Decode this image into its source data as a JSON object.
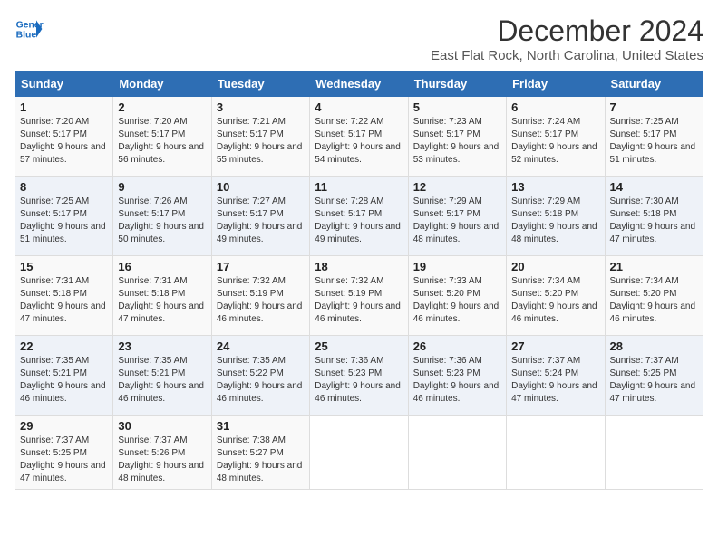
{
  "header": {
    "logo_line1": "General",
    "logo_line2": "Blue",
    "month": "December 2024",
    "location": "East Flat Rock, North Carolina, United States"
  },
  "days_of_week": [
    "Sunday",
    "Monday",
    "Tuesday",
    "Wednesday",
    "Thursday",
    "Friday",
    "Saturday"
  ],
  "weeks": [
    [
      {
        "num": "1",
        "rise": "7:20 AM",
        "set": "5:17 PM",
        "daylight": "9 hours and 57 minutes."
      },
      {
        "num": "2",
        "rise": "7:20 AM",
        "set": "5:17 PM",
        "daylight": "9 hours and 56 minutes."
      },
      {
        "num": "3",
        "rise": "7:21 AM",
        "set": "5:17 PM",
        "daylight": "9 hours and 55 minutes."
      },
      {
        "num": "4",
        "rise": "7:22 AM",
        "set": "5:17 PM",
        "daylight": "9 hours and 54 minutes."
      },
      {
        "num": "5",
        "rise": "7:23 AM",
        "set": "5:17 PM",
        "daylight": "9 hours and 53 minutes."
      },
      {
        "num": "6",
        "rise": "7:24 AM",
        "set": "5:17 PM",
        "daylight": "9 hours and 52 minutes."
      },
      {
        "num": "7",
        "rise": "7:25 AM",
        "set": "5:17 PM",
        "daylight": "9 hours and 51 minutes."
      }
    ],
    [
      {
        "num": "8",
        "rise": "7:25 AM",
        "set": "5:17 PM",
        "daylight": "9 hours and 51 minutes."
      },
      {
        "num": "9",
        "rise": "7:26 AM",
        "set": "5:17 PM",
        "daylight": "9 hours and 50 minutes."
      },
      {
        "num": "10",
        "rise": "7:27 AM",
        "set": "5:17 PM",
        "daylight": "9 hours and 49 minutes."
      },
      {
        "num": "11",
        "rise": "7:28 AM",
        "set": "5:17 PM",
        "daylight": "9 hours and 49 minutes."
      },
      {
        "num": "12",
        "rise": "7:29 AM",
        "set": "5:17 PM",
        "daylight": "9 hours and 48 minutes."
      },
      {
        "num": "13",
        "rise": "7:29 AM",
        "set": "5:18 PM",
        "daylight": "9 hours and 48 minutes."
      },
      {
        "num": "14",
        "rise": "7:30 AM",
        "set": "5:18 PM",
        "daylight": "9 hours and 47 minutes."
      }
    ],
    [
      {
        "num": "15",
        "rise": "7:31 AM",
        "set": "5:18 PM",
        "daylight": "9 hours and 47 minutes."
      },
      {
        "num": "16",
        "rise": "7:31 AM",
        "set": "5:18 PM",
        "daylight": "9 hours and 47 minutes."
      },
      {
        "num": "17",
        "rise": "7:32 AM",
        "set": "5:19 PM",
        "daylight": "9 hours and 46 minutes."
      },
      {
        "num": "18",
        "rise": "7:32 AM",
        "set": "5:19 PM",
        "daylight": "9 hours and 46 minutes."
      },
      {
        "num": "19",
        "rise": "7:33 AM",
        "set": "5:20 PM",
        "daylight": "9 hours and 46 minutes."
      },
      {
        "num": "20",
        "rise": "7:34 AM",
        "set": "5:20 PM",
        "daylight": "9 hours and 46 minutes."
      },
      {
        "num": "21",
        "rise": "7:34 AM",
        "set": "5:20 PM",
        "daylight": "9 hours and 46 minutes."
      }
    ],
    [
      {
        "num": "22",
        "rise": "7:35 AM",
        "set": "5:21 PM",
        "daylight": "9 hours and 46 minutes."
      },
      {
        "num": "23",
        "rise": "7:35 AM",
        "set": "5:21 PM",
        "daylight": "9 hours and 46 minutes."
      },
      {
        "num": "24",
        "rise": "7:35 AM",
        "set": "5:22 PM",
        "daylight": "9 hours and 46 minutes."
      },
      {
        "num": "25",
        "rise": "7:36 AM",
        "set": "5:23 PM",
        "daylight": "9 hours and 46 minutes."
      },
      {
        "num": "26",
        "rise": "7:36 AM",
        "set": "5:23 PM",
        "daylight": "9 hours and 46 minutes."
      },
      {
        "num": "27",
        "rise": "7:37 AM",
        "set": "5:24 PM",
        "daylight": "9 hours and 47 minutes."
      },
      {
        "num": "28",
        "rise": "7:37 AM",
        "set": "5:25 PM",
        "daylight": "9 hours and 47 minutes."
      }
    ],
    [
      {
        "num": "29",
        "rise": "7:37 AM",
        "set": "5:25 PM",
        "daylight": "9 hours and 47 minutes."
      },
      {
        "num": "30",
        "rise": "7:37 AM",
        "set": "5:26 PM",
        "daylight": "9 hours and 48 minutes."
      },
      {
        "num": "31",
        "rise": "7:38 AM",
        "set": "5:27 PM",
        "daylight": "9 hours and 48 minutes."
      },
      null,
      null,
      null,
      null
    ]
  ],
  "labels": {
    "sunrise": "Sunrise:",
    "sunset": "Sunset:",
    "daylight": "Daylight:"
  }
}
